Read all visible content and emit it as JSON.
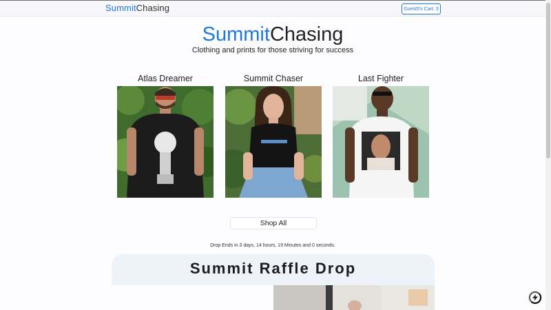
{
  "nav": {
    "brand_part1": "Summit",
    "brand_part2": "Chasing",
    "cart_label": "Guest5's Cart: 3"
  },
  "hero": {
    "title_part1": "Summit",
    "title_part2": "Chasing",
    "subtitle": "Clothing and prints for those striving for success"
  },
  "products": [
    {
      "name": "Atlas Dreamer",
      "shirt_color": "#1c1c1c"
    },
    {
      "name": "Summit Chaser",
      "shirt_color": "#141414",
      "shirt_text": "SummitChasing"
    },
    {
      "name": "Last Fighter",
      "shirt_color": "#f5f5f5"
    }
  ],
  "shop_all_label": "Shop All",
  "drop_countdown": "Drop Ends in 3 days, 14 hours, 19 Minutes and 0 seconds.",
  "raffle": {
    "title": "Summit Raffle Drop"
  },
  "colors": {
    "brand_blue": "#1d79e0",
    "raffle_bg": "#eef3fa"
  },
  "icons": {
    "bolt": "lightning-bolt-icon"
  }
}
